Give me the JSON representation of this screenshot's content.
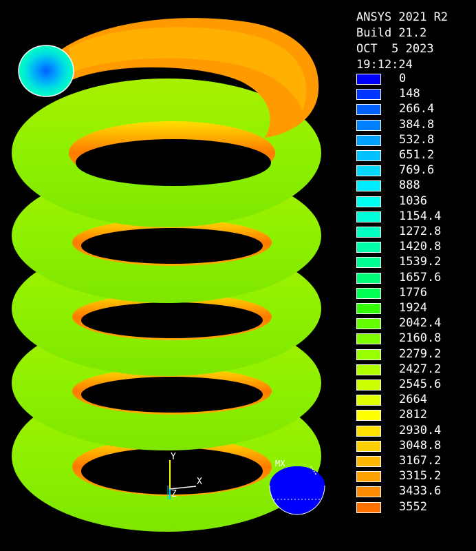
{
  "header": {
    "product": "ANSYS 2021 R2",
    "build": "Build 21.2",
    "date": "OCT  5 2023",
    "time": "19:12:24"
  },
  "legend": {
    "labels": [
      "0",
      "148",
      "266.4",
      "384.8",
      "532.8",
      "651.2",
      "769.6",
      "888",
      "1036",
      "1154.4",
      "1272.8",
      "1420.8",
      "1539.2",
      "1657.6",
      "1776",
      "1924",
      "2042.4",
      "2160.8",
      "2279.2",
      "2427.2",
      "2545.6",
      "2664",
      "2812",
      "2930.4",
      "3048.8",
      "3167.2",
      "3315.2",
      "3433.6",
      "3552"
    ],
    "colors": [
      "#0000ff",
      "#0035ff",
      "#0060ff",
      "#0080ff",
      "#00a0ff",
      "#00c0ff",
      "#00d8ff",
      "#00eeff",
      "#00ffee",
      "#00ffd8",
      "#00ffc0",
      "#00ffa8",
      "#00ff90",
      "#00ff78",
      "#00ff55",
      "#33ff00",
      "#66ff00",
      "#80ff00",
      "#99ff00",
      "#b0ff00",
      "#ccff00",
      "#e0ff00",
      "#ffff00",
      "#ffe000",
      "#ffd000",
      "#ffb800",
      "#ffa000",
      "#ff8c00",
      "#ff7000"
    ]
  },
  "axes": {
    "x": "X",
    "y": "Y",
    "z": "Z"
  },
  "markers": {
    "max": "MX"
  },
  "colors": {
    "background": "#000000",
    "coil_main": "#8ef100",
    "coil_inner": "#ff7a00",
    "min_marker": "#0000ff"
  }
}
